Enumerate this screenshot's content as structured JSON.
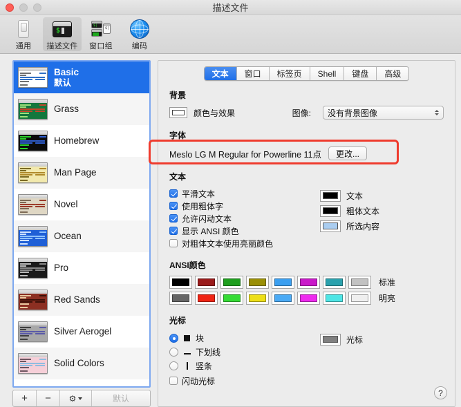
{
  "window": {
    "title": "描述文件",
    "traffic": {
      "close": "close-button",
      "minimize": "minimize-button",
      "maximize": "maximize-button"
    }
  },
  "toolbar": {
    "items": [
      {
        "label": "通用",
        "icon": "toggle-switch-icon",
        "selected": false
      },
      {
        "label": "描述文件",
        "icon": "terminal-icon",
        "selected": true
      },
      {
        "label": "窗口组",
        "icon": "window-group-icon",
        "selected": false
      },
      {
        "label": "编码",
        "icon": "globe-icon",
        "selected": false
      }
    ]
  },
  "sidebar": {
    "profiles": [
      {
        "name": "Basic",
        "subtitle": "默认",
        "selected": true,
        "thumb": {
          "bg": "#ffffff",
          "fg": "#6f6f6f",
          "accent": "#2f6fc4"
        }
      },
      {
        "name": "Grass",
        "subtitle": "",
        "selected": false,
        "thumb": {
          "bg": "#13773d",
          "fg": "#9ee07a",
          "accent": "#c4442a"
        }
      },
      {
        "name": "Homebrew",
        "subtitle": "",
        "selected": false,
        "thumb": {
          "bg": "#0b0b0b",
          "fg": "#2bd52b",
          "accent": "#2f5fd0"
        }
      },
      {
        "name": "Man Page",
        "subtitle": "",
        "selected": false,
        "thumb": {
          "bg": "#f2e9ad",
          "fg": "#7a6a22",
          "accent": "#b08a2a"
        }
      },
      {
        "name": "Novel",
        "subtitle": "",
        "selected": false,
        "thumb": {
          "bg": "#dfd7c4",
          "fg": "#7d6a55",
          "accent": "#9c3b2a"
        }
      },
      {
        "name": "Ocean",
        "subtitle": "",
        "selected": false,
        "thumb": {
          "bg": "#1f5fd6",
          "fg": "#cfe2ff",
          "accent": "#8fc2ff"
        }
      },
      {
        "name": "Pro",
        "subtitle": "",
        "selected": false,
        "thumb": {
          "bg": "#1a1a1a",
          "fg": "#bdbdbd",
          "accent": "#8a8a8a"
        }
      },
      {
        "name": "Red Sands",
        "subtitle": "",
        "selected": false,
        "thumb": {
          "bg": "#8c2f22",
          "fg": "#e8c9a0",
          "accent": "#3a1008"
        }
      },
      {
        "name": "Silver Aerogel",
        "subtitle": "",
        "selected": false,
        "thumb": {
          "bg": "#a8a8a8",
          "fg": "#3f3f3f",
          "accent": "#5a5aa8"
        }
      },
      {
        "name": "Solid Colors",
        "subtitle": "",
        "selected": false,
        "thumb": {
          "bg": "#f6cfd8",
          "fg": "#6e5560",
          "accent": "#8fbce0"
        }
      }
    ],
    "toolbar": {
      "add": "+",
      "remove": "−",
      "gear": "⚙",
      "default_label": "默认"
    }
  },
  "panel": {
    "tabs": [
      {
        "label": "文本",
        "active": true
      },
      {
        "label": "窗口",
        "active": false
      },
      {
        "label": "标签页",
        "active": false
      },
      {
        "label": "Shell",
        "active": false
      },
      {
        "label": "键盘",
        "active": false
      },
      {
        "label": "高级",
        "active": false
      }
    ],
    "background": {
      "section_title": "背景",
      "color_effects_label": "颜色与效果",
      "color_value": "#ffffff",
      "image_label": "图像:",
      "image_value": "没有背景图像"
    },
    "font": {
      "section_title": "字体",
      "value": "Meslo LG M Regular for Powerline 11点",
      "change_button": "更改..."
    },
    "text": {
      "section_title": "文本",
      "checkboxes": [
        {
          "label": "平滑文本",
          "checked": true
        },
        {
          "label": "使用粗体字",
          "checked": true
        },
        {
          "label": "允许闪动文本",
          "checked": true
        },
        {
          "label": "显示 ANSI 颜色",
          "checked": true
        },
        {
          "label": "对粗体文本使用亮丽颜色",
          "checked": false
        }
      ],
      "swatches": [
        {
          "label": "文本",
          "color": "#000000"
        },
        {
          "label": "粗体文本",
          "color": "#000000"
        },
        {
          "label": "所选内容",
          "color": "#aacdf0"
        }
      ]
    },
    "ansi": {
      "section_title": "ANSI颜色",
      "normal_label": "标准",
      "bright_label": "明亮",
      "normal_colors": [
        "#000000",
        "#991b1b",
        "#1e9e1e",
        "#9a8f06",
        "#3b9ff0",
        "#c919c9",
        "#2aa1ad",
        "#c2c2c2"
      ],
      "bright_colors": [
        "#666666",
        "#ef2414",
        "#35db35",
        "#eddf18",
        "#4aaaf5",
        "#ee2aee",
        "#4ee5e5",
        "#efefef"
      ]
    },
    "cursor": {
      "section_title": "光标",
      "options": [
        {
          "label": "块",
          "glyph": "block",
          "selected": true
        },
        {
          "label": "下划线",
          "glyph": "underline",
          "selected": false
        },
        {
          "label": "竖条",
          "glyph": "bar",
          "selected": false
        }
      ],
      "blink_label": "闪动光标",
      "blink_checked": false,
      "swatch_label": "光标",
      "swatch_color": "#808080"
    },
    "help_button": "?"
  },
  "annotation": {
    "color": "#ef3b2d"
  }
}
